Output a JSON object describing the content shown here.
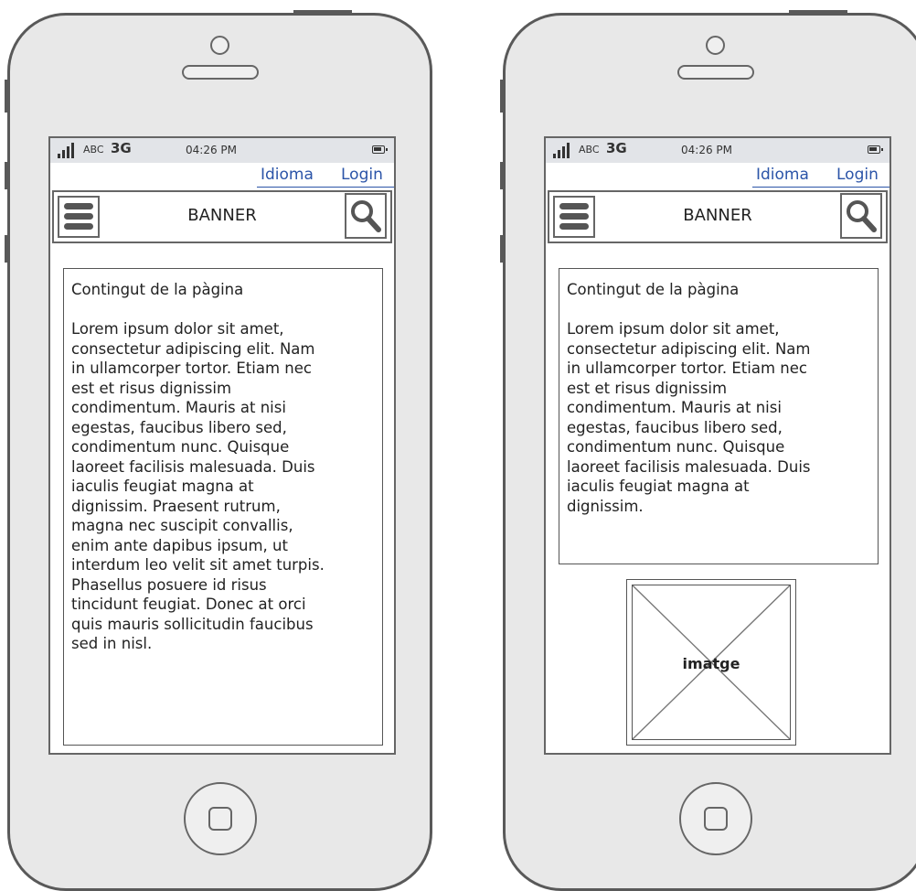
{
  "colors": {
    "device_body": "#e8e8e8",
    "device_outline": "#595959",
    "status_bar": "#e2e4e8",
    "link": "#2b54a8"
  },
  "phones": [
    {
      "status_bar": {
        "carrier": "ABC",
        "network": "3G",
        "time": "04:26 PM",
        "signal_icon": "signal-bars-icon",
        "battery_icon": "battery-icon"
      },
      "top_links": {
        "language": "Idioma",
        "login": "Login"
      },
      "banner": {
        "label": "BANNER",
        "menu_icon": "hamburger-menu-icon",
        "search_icon": "search-icon"
      },
      "content": {
        "title": "Contingut de la pàgina",
        "text": "Lorem ipsum dolor sit amet,\nconsectetur adipiscing elit. Nam\nin ullamcorper tortor. Etiam nec\nest et risus dignissim\ncondimentum. Mauris at nisi\negestas, faucibus libero sed,\ncondimentum nunc. Quisque\nlaoreet facilisis malesuada. Duis\niaculis feugiat magna at\ndignissim. Praesent rutrum,\nmagna nec suscipit convallis,\nenim ante dapibus ipsum, ut\ninterdum leo velit sit amet turpis.\nPhasellus posuere id risus\ntincidunt feugiat. Donec at orci\nquis mauris sollicitudin faucibus\nsed in nisl."
      }
    },
    {
      "status_bar": {
        "carrier": "ABC",
        "network": "3G",
        "time": "04:26 PM",
        "signal_icon": "signal-bars-icon",
        "battery_icon": "battery-icon"
      },
      "top_links": {
        "language": "Idioma",
        "login": "Login"
      },
      "banner": {
        "label": "BANNER",
        "menu_icon": "hamburger-menu-icon",
        "search_icon": "search-icon"
      },
      "content": {
        "title": "Contingut de la pàgina",
        "text": "Lorem ipsum dolor sit amet,\nconsectetur adipiscing elit. Nam\nin ullamcorper tortor. Etiam nec\nest et risus dignissim\ncondimentum. Mauris at nisi\negestas, faucibus libero sed,\ncondimentum nunc. Quisque\nlaoreet facilisis malesuada. Duis\niaculis feugiat magna at\ndignissim."
      },
      "image_placeholder": {
        "label": "imatge"
      }
    }
  ]
}
